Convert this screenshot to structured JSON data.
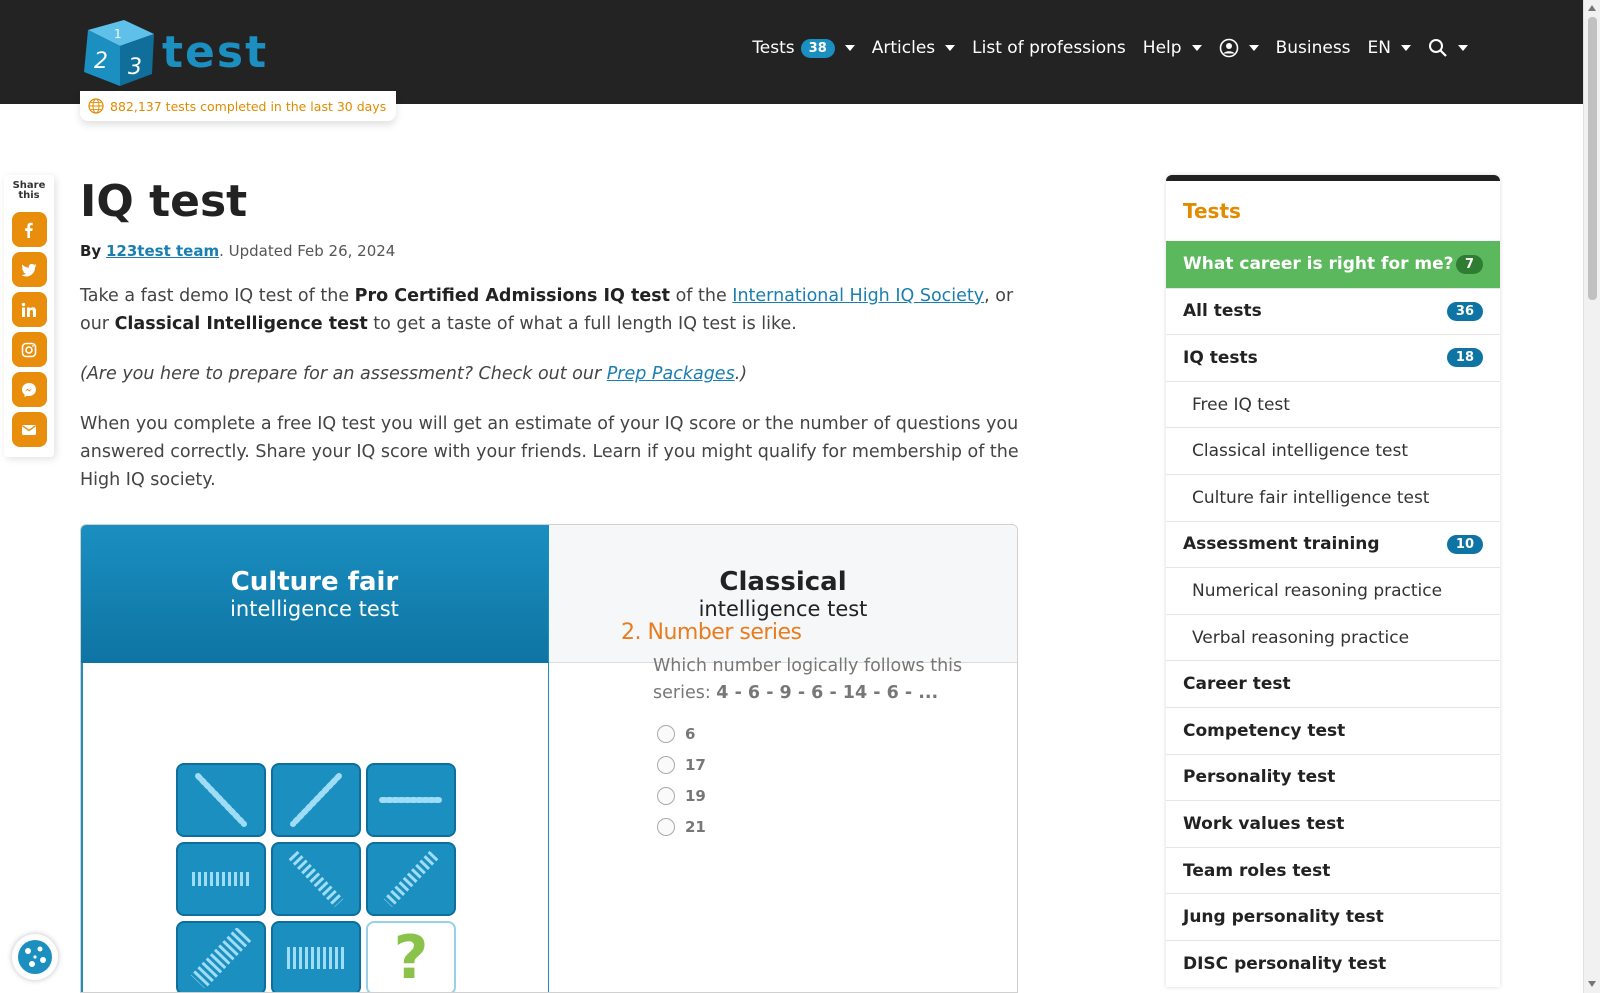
{
  "header": {
    "logo_text": "test",
    "nav": {
      "tests_label": "Tests",
      "tests_count": "38",
      "articles_label": "Articles",
      "professions_label": "List of professions",
      "help_label": "Help",
      "business_label": "Business",
      "language_label": "EN"
    },
    "counter_text": "882,137 tests completed in the last 30 days"
  },
  "share": {
    "label": "Share this",
    "buttons": [
      "facebook-icon",
      "twitter-icon",
      "linkedin-icon",
      "instagram-icon",
      "messenger-icon",
      "email-icon"
    ]
  },
  "article": {
    "title": "IQ test",
    "by": "By",
    "author": "123test team",
    "updated": ". Updated Feb 26, 2024",
    "intro": {
      "p1": "Take a fast demo IQ test of the ",
      "b1": "Pro Certified Admissions IQ test",
      "p2": " of the ",
      "link1": "International High IQ Society",
      "p3": ", or our ",
      "b2": "Classical Intelligence test",
      "p4": " to get a taste of what a full length IQ test is like."
    },
    "prep": {
      "p1": "(Are you here to prepare for an assessment? Check out our ",
      "link": "Prep Packages",
      "p2": ".)"
    },
    "body": "When you complete a free IQ test you will get an estimate of your IQ score or the number of questions you answered correctly. Share your IQ score with your friends. Learn if you might qualify for membership of the High IQ society."
  },
  "cards": {
    "left": {
      "title": "Culture fair",
      "subtitle": "intelligence test",
      "question_mark": "?"
    },
    "right": {
      "title": "Classical",
      "subtitle": "intelligence test",
      "question_title": "2. Number series",
      "question_text": "Which number logically follows this series: ",
      "series": "4 - 6 - 9 - 6 - 14 - 6 - ...",
      "options": [
        "6",
        "17",
        "19",
        "21"
      ]
    }
  },
  "sidebar": {
    "heading": "Tests",
    "items": [
      {
        "label": "What career is right for me?",
        "badge": "7",
        "type": "active"
      },
      {
        "label": "All tests",
        "badge": "36",
        "type": "main"
      },
      {
        "label": "IQ tests",
        "badge": "18",
        "type": "main"
      },
      {
        "label": "Free IQ test",
        "badge": "",
        "type": "sub"
      },
      {
        "label": "Classical intelligence test",
        "badge": "",
        "type": "sub"
      },
      {
        "label": "Culture fair intelligence test",
        "badge": "",
        "type": "sub"
      },
      {
        "label": "Assessment training",
        "badge": "10",
        "type": "main"
      },
      {
        "label": "Numerical reasoning practice",
        "badge": "",
        "type": "sub"
      },
      {
        "label": "Verbal reasoning practice",
        "badge": "",
        "type": "sub"
      },
      {
        "label": "Career test",
        "badge": "",
        "type": "main"
      },
      {
        "label": "Competency test",
        "badge": "",
        "type": "main"
      },
      {
        "label": "Personality test",
        "badge": "",
        "type": "main"
      },
      {
        "label": "Work values test",
        "badge": "",
        "type": "main"
      },
      {
        "label": "Team roles test",
        "badge": "",
        "type": "main"
      },
      {
        "label": "Jung personality test",
        "badge": "",
        "type": "main"
      },
      {
        "label": "DISC personality test",
        "badge": "",
        "type": "main"
      }
    ]
  },
  "colors": {
    "brand_blue": "#1a8fc0",
    "orange": "#e88e0c",
    "active_green": "#5cb85c",
    "header_bg": "#232323"
  }
}
